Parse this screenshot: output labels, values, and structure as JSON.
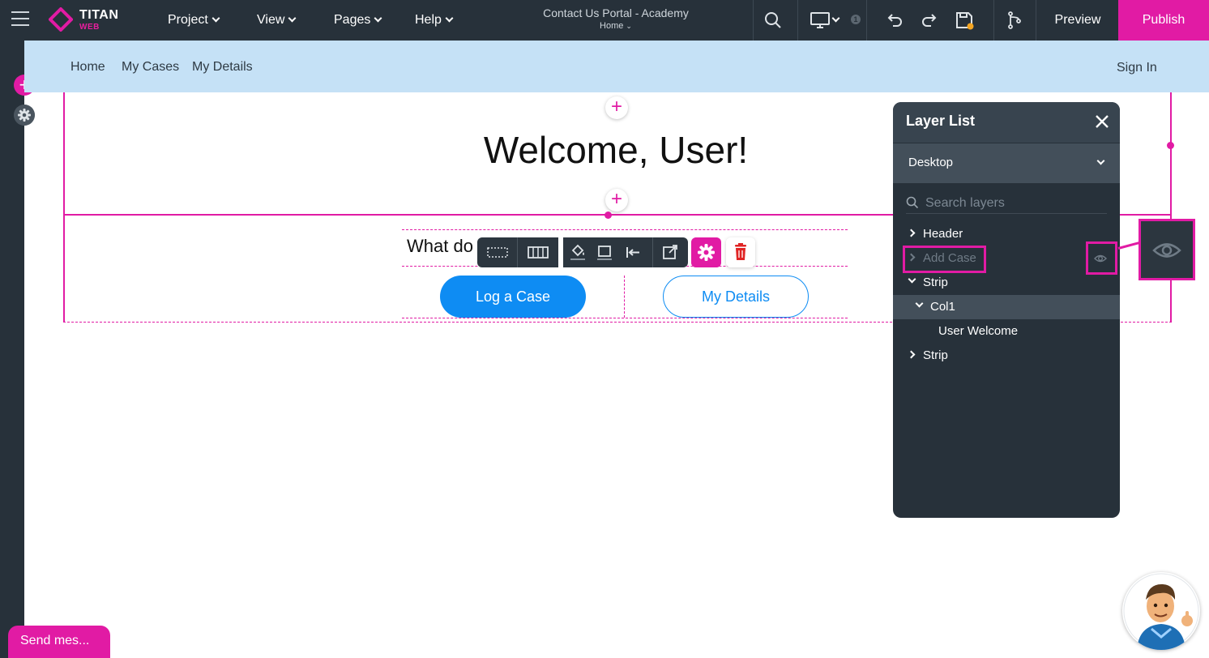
{
  "topbar": {
    "logo_title": "TITAN",
    "logo_sub": "WEB",
    "menus": [
      {
        "label": "Project"
      },
      {
        "label": "View"
      },
      {
        "label": "Pages"
      },
      {
        "label": "Help"
      }
    ],
    "doc_title": "Contact Us Portal - Academy",
    "doc_page": "Home",
    "device_badge": "1",
    "preview_label": "Preview",
    "publish_label": "Publish"
  },
  "site_nav": {
    "links": [
      "Home",
      "My Cases",
      "My Details"
    ],
    "sign_in": "Sign In"
  },
  "canvas": {
    "welcome": "Welcome, User!",
    "question": "What do",
    "log_case_label": "Log a Case",
    "my_details_label": "My Details"
  },
  "layer_panel": {
    "title": "Layer List",
    "device_select": "Desktop",
    "search_placeholder": "Search layers",
    "items": [
      {
        "label": "Header"
      },
      {
        "label": "Add Case"
      },
      {
        "label": "Strip"
      },
      {
        "label": "Col1"
      },
      {
        "label": "User Welcome"
      },
      {
        "label": "Strip"
      }
    ]
  },
  "chat": {
    "send_message": "Send mes..."
  },
  "colors": {
    "accent": "#e11ba4",
    "topbar": "#27313a",
    "primary_button": "#0e8cf3",
    "site_nav_bg": "#c5e1f6"
  }
}
